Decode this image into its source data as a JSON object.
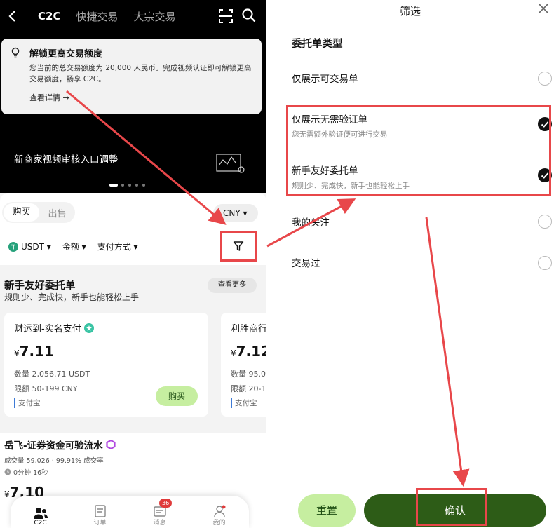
{
  "left": {
    "nav": {
      "tabs": [
        "C2C",
        "快捷交易",
        "大宗交易"
      ]
    },
    "notice": {
      "title": "解锁更高交易额度",
      "body": "您当前的总交易额度为 20,000 人民币。完成视频认证即可解锁更高交易额度，畅享 C2C。",
      "link": "查看详情 →"
    },
    "banner": {
      "text": "新商家视频审核入口调整"
    },
    "market": {
      "buy": "购买",
      "sell": "出售",
      "currency": "CNY",
      "filters": [
        "USDT",
        "金额",
        "支付方式"
      ]
    },
    "newbie": {
      "title": "新手友好委托单",
      "subtitle": "规则少、完成快，新手也能轻松上手",
      "more": "查看更多",
      "cards": [
        {
          "name": "财运到-实名支付",
          "currency_symbol": "¥",
          "price": "7.11",
          "qty": "数量 2,056.71 USDT",
          "limit": "限额 50-199 CNY",
          "pay": "支付宝",
          "action": "购买"
        },
        {
          "name": "利胜商行",
          "currency_symbol": "¥",
          "price": "7.12",
          "qty": "数量 95.0",
          "limit": "限额 20-1",
          "pay": "支付宝"
        }
      ]
    },
    "merchant": {
      "name": "岳飞-证券资金可验流水",
      "stats": "成交量 59,026 · 99.91% 成交率",
      "time": "0分钟 16秒",
      "currency_symbol": "¥",
      "price": "7.10"
    },
    "bottom_nav": {
      "items": [
        "C2C",
        "订单",
        "消息",
        "我的"
      ],
      "badge": "36"
    }
  },
  "right": {
    "title": "筛选",
    "section": "委托单类型",
    "options": [
      {
        "label": "仅展示可交易单",
        "desc": "",
        "checked": false
      },
      {
        "label": "仅展示无需验证单",
        "desc": "您无需额外验证便可进行交易",
        "checked": true
      },
      {
        "label": "新手友好委托单",
        "desc": "规则少、完成快，新手也能轻松上手",
        "checked": true
      },
      {
        "label": "我的关注",
        "desc": "",
        "checked": false
      },
      {
        "label": "交易过",
        "desc": "",
        "checked": false
      }
    ],
    "reset": "重置",
    "confirm": "确认"
  },
  "colors": {
    "accent_green": "#2d5c17",
    "light_green": "#c6eea0",
    "annotation_red": "#e8474a"
  }
}
